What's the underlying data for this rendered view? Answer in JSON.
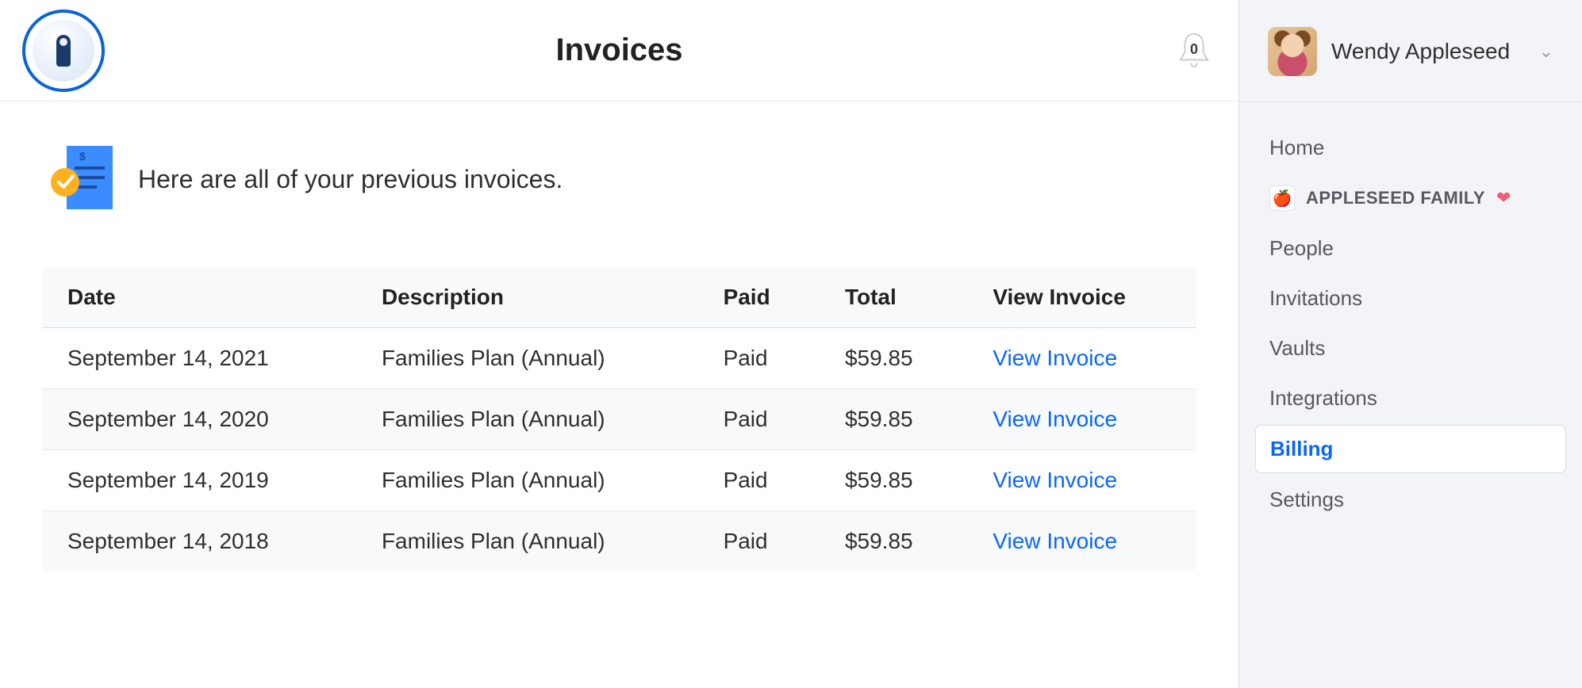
{
  "header": {
    "title": "Invoices",
    "notification_count": "0"
  },
  "intro": {
    "text": "Here are all of your previous invoices."
  },
  "table": {
    "headers": {
      "date": "Date",
      "description": "Description",
      "paid": "Paid",
      "total": "Total",
      "view": "View Invoice"
    },
    "rows": [
      {
        "date": "September 14, 2021",
        "description": "Families Plan (Annual)",
        "paid": "Paid",
        "total": "$59.85",
        "view": "View Invoice"
      },
      {
        "date": "September 14, 2020",
        "description": "Families Plan (Annual)",
        "paid": "Paid",
        "total": "$59.85",
        "view": "View Invoice"
      },
      {
        "date": "September 14, 2019",
        "description": "Families Plan (Annual)",
        "paid": "Paid",
        "total": "$59.85",
        "view": "View Invoice"
      },
      {
        "date": "September 14, 2018",
        "description": "Families Plan (Annual)",
        "paid": "Paid",
        "total": "$59.85",
        "view": "View Invoice"
      }
    ]
  },
  "sidebar": {
    "user_name": "Wendy Appleseed",
    "family_label": "APPLESEED FAMILY",
    "nav": {
      "home": "Home",
      "people": "People",
      "invitations": "Invitations",
      "vaults": "Vaults",
      "integrations": "Integrations",
      "billing": "Billing",
      "settings": "Settings"
    }
  }
}
